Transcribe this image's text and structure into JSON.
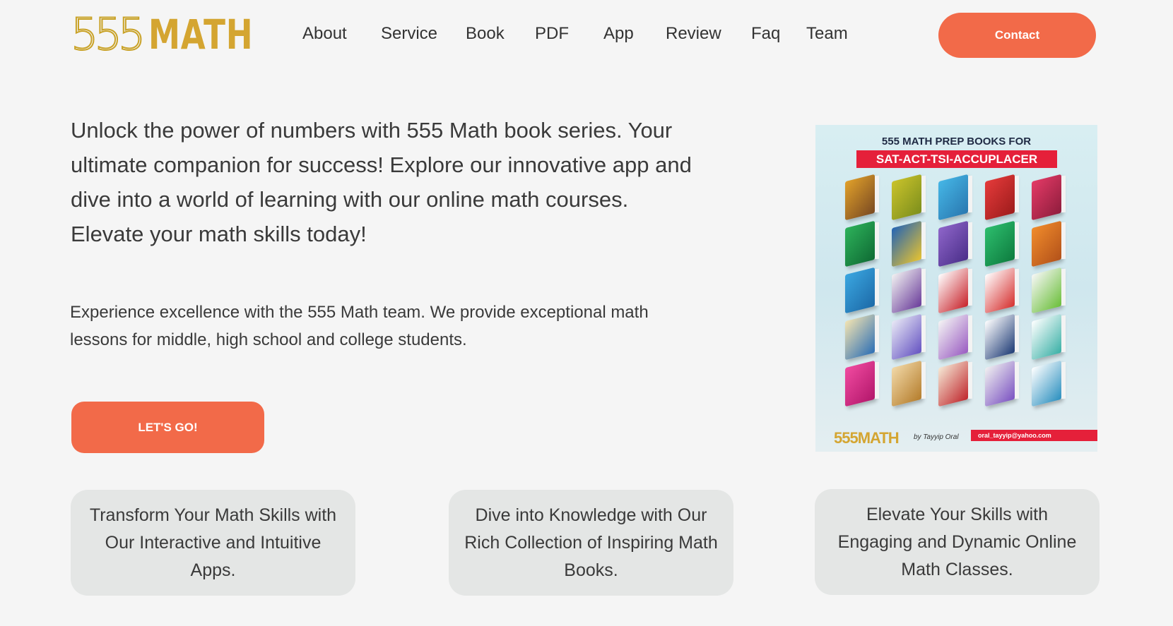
{
  "header": {
    "logo": {
      "number": "555",
      "word": "MATH"
    },
    "nav": [
      "About",
      "Service",
      "Book",
      "PDF",
      "App",
      "Review",
      "Faq",
      "Team"
    ],
    "contact_label": "Contact"
  },
  "hero": {
    "headline": "Unlock the power of numbers with 555 Math book series. Your ultimate companion for success! Explore our innovative app and dive into a world of learning with our online math courses. Elevate your math skills today!",
    "subtext": "Experience excellence with the 555 Math team. We provide exceptional math lessons for middle, high school and college students.",
    "cta_label": "LET'S GO!"
  },
  "poster": {
    "title": "555 MATH PREP BOOKS FOR",
    "banner": "SAT-ACT-TSI-ACCUPLACER",
    "logo": "555MATH",
    "by": "by Tayyip Oral",
    "email": "oral_tayyip@yahoo.com"
  },
  "cards": [
    "Transform Your Math Skills with Our Interactive and Intuitive Apps.",
    "Dive into Knowledge with Our Rich Collection of Inspiring Math Books.",
    "Elevate Your Skills with Engaging and Dynamic Online Math Classes."
  ],
  "colors": {
    "accent": "#f26a49",
    "gold": "#d4a531",
    "background": "#f5f5f5",
    "card": "#e4e6e5",
    "banner_red": "#e5203a"
  }
}
